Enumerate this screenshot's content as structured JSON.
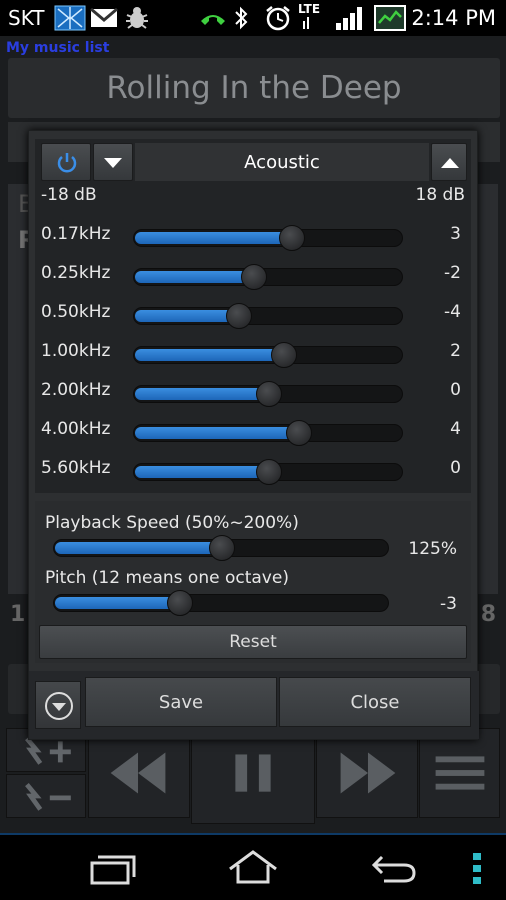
{
  "status_bar": {
    "carrier": "SKT",
    "network": "LTE",
    "time": "2:14 PM",
    "icons": [
      "network-activity-icon",
      "gmail-icon",
      "bug-icon",
      "phone-icon",
      "bluetooth-icon",
      "alarm-icon",
      "lte-signal-icon",
      "battery-icon"
    ]
  },
  "app": {
    "list_link": "My music list",
    "song_title": "Rolling In the Deep",
    "bg_text_left_1": "B",
    "bg_text_left_2": "R",
    "bg_time_left": "1",
    "bg_time_right": "8"
  },
  "equalizer": {
    "preset": "Acoustic",
    "min_db": "-18 dB",
    "max_db": "18 dB",
    "range": [
      -18,
      18
    ],
    "bands": [
      {
        "freq": "0.17kHz",
        "value": "3",
        "level": 3
      },
      {
        "freq": "0.25kHz",
        "value": "-2",
        "level": -2
      },
      {
        "freq": "0.50kHz",
        "value": "-4",
        "level": -4
      },
      {
        "freq": "1.00kHz",
        "value": "2",
        "level": 2
      },
      {
        "freq": "2.00kHz",
        "value": "0",
        "level": 0
      },
      {
        "freq": "4.00kHz",
        "value": "4",
        "level": 4
      },
      {
        "freq": "5.60kHz",
        "value": "0",
        "level": 0
      }
    ],
    "playback_speed": {
      "label": "Playback Speed (50%~200%)",
      "value": "125%",
      "fraction": 0.5
    },
    "pitch": {
      "label": "Pitch (12 means one octave)",
      "value": "-3",
      "fraction": 0.375
    },
    "reset_label": "Reset",
    "save_label": "Save",
    "close_label": "Close"
  },
  "colors": {
    "accent": "#2a78d0",
    "status_link": "#2a3ee0"
  }
}
